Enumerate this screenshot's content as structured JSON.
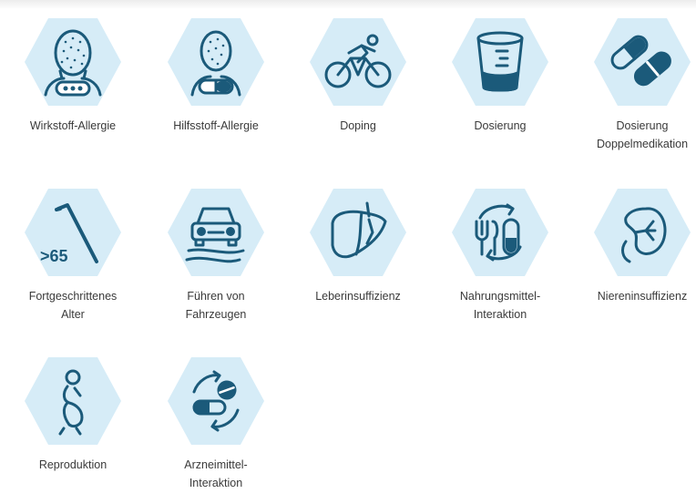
{
  "items": [
    {
      "label": "Wirkstoff-Allergie",
      "icon": "face-allergy-icon"
    },
    {
      "label": "Hilfsstoff-Allergie",
      "icon": "head-capsule-icon"
    },
    {
      "label": "Doping",
      "icon": "cyclist-icon"
    },
    {
      "label": "Dosierung",
      "icon": "measuring-cup-icon"
    },
    {
      "label": "Dosierung\nDoppelmedikation",
      "icon": "two-capsules-icon"
    },
    {
      "label": "Fortgeschrittenes\nAlter",
      "icon": "walking-cane-icon",
      "badge": ">65"
    },
    {
      "label": "Führen von\nFahrzeugen",
      "icon": "car-icon"
    },
    {
      "label": "Leberinsuffizienz",
      "icon": "liver-icon"
    },
    {
      "label": "Nahrungsmittel-\nInteraktion",
      "icon": "food-capsule-interaction-icon"
    },
    {
      "label": "Niereninsuffizienz",
      "icon": "kidney-icon"
    },
    {
      "label": "Reproduktion",
      "icon": "pregnancy-icon"
    },
    {
      "label": "Arzneimittel-\nInteraktion",
      "icon": "drug-interaction-icon"
    }
  ],
  "colors": {
    "hex_fill": "#d6ecf7",
    "icon_stroke": "#1b5a7a",
    "text": "#3a3a3a"
  }
}
